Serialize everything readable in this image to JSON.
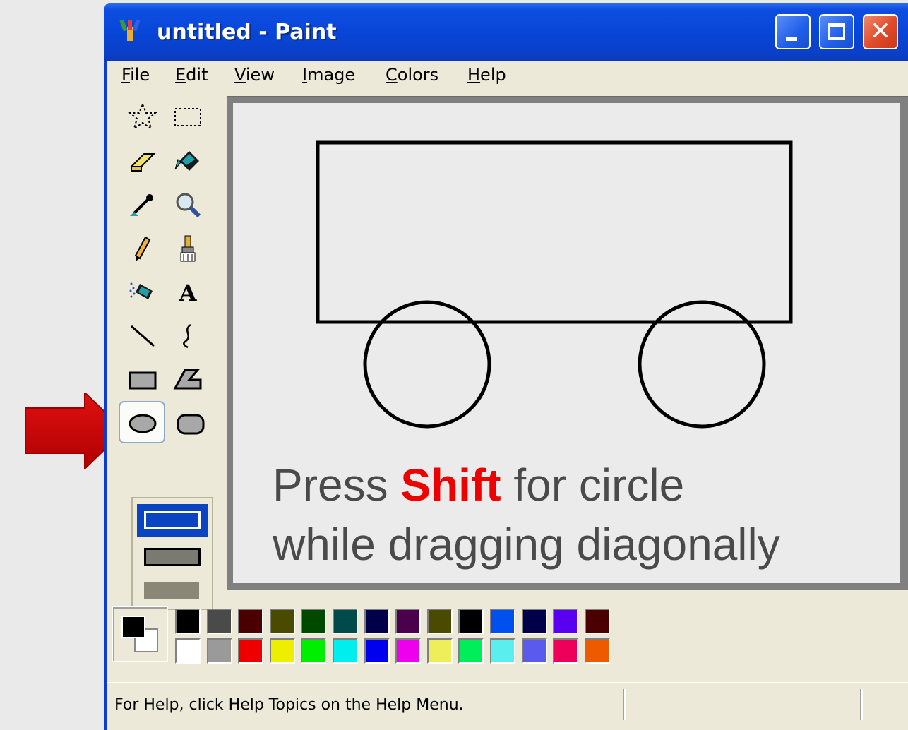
{
  "window": {
    "title": "untitled - Paint",
    "close_glyph": "✕"
  },
  "menu": [
    {
      "label": "File",
      "accel": "F",
      "rest": "ile"
    },
    {
      "label": "Edit",
      "accel": "E",
      "rest": "dit"
    },
    {
      "label": "View",
      "accel": "V",
      "rest": "iew"
    },
    {
      "label": "Image",
      "accel": "I",
      "rest": "mage"
    },
    {
      "label": "Colors",
      "accel": "C",
      "rest": "olors"
    },
    {
      "label": "Help",
      "accel": "H",
      "rest": "elp"
    }
  ],
  "tools": [
    "free-form-select-icon",
    "select-icon",
    "eraser-icon",
    "fill-with-color-icon",
    "pick-color-icon",
    "magnifier-icon",
    "pencil-icon",
    "brush-icon",
    "airbrush-icon",
    "text-icon",
    "line-icon",
    "curve-icon",
    "rectangle-icon",
    "polygon-icon",
    "ellipse-icon",
    "rounded-rectangle-icon"
  ],
  "selected_tool": "ellipse-icon",
  "text_tool_glyph": "A",
  "caption": {
    "line1_before": "Press ",
    "line1_highlight": "Shift",
    "line1_after": " for circle",
    "line2": "while dragging diagonally",
    "highlight_color": "#ee0000"
  },
  "palette": {
    "foreground": "#000000",
    "background": "#ffffff",
    "top_row": [
      "#000000",
      "#4a4a4a",
      "#4a0000",
      "#4a4a00",
      "#004a00",
      "#004a4a",
      "#00004a",
      "#4a004a",
      "#4a4a00",
      "#000000",
      "#0050f0",
      "#00004a",
      "#5a00f0",
      "#4a0000"
    ],
    "bottom_row": [
      "#ffffff",
      "#9a9a9a",
      "#ee0000",
      "#eeee00",
      "#00ee00",
      "#00eeee",
      "#0000ee",
      "#ee00ee",
      "#eeee5a",
      "#00ee5a",
      "#5aeeee",
      "#5a5aee",
      "#ee005a",
      "#ee5a00"
    ]
  },
  "status": {
    "help_text": "For Help, click Help Topics on the Help Menu."
  },
  "accent": {
    "titlebar": "#0846d8",
    "arrow": "#c80000"
  }
}
